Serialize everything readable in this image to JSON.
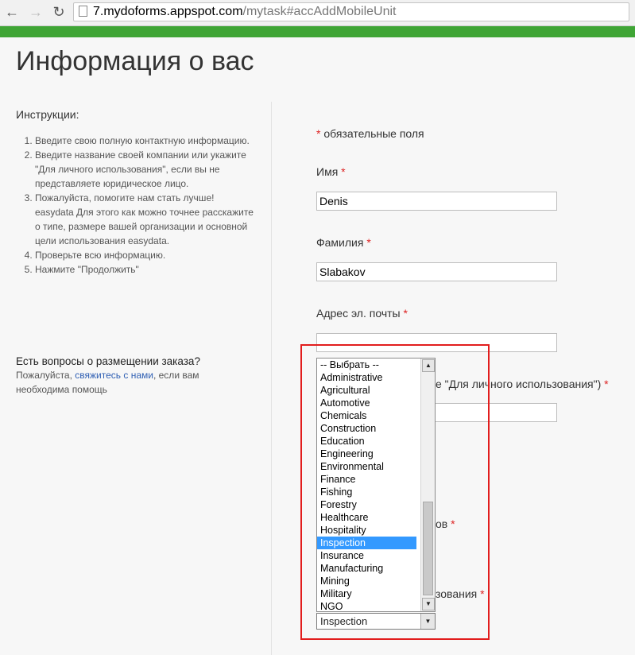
{
  "browser": {
    "url_host": "7.mydoforms.appspot.com",
    "url_path": "/mytask#accAddMobileUnit"
  },
  "page": {
    "title": "Информация о вас"
  },
  "instructions": {
    "title": "Инструкции:",
    "items": [
      "Введите свою полную контактную информацию.",
      "Введите название своей компании или укажите \"Для личного использования\", если вы не представляете юридическое лицо.",
      "Пожалуйста, помогите нам стать лучше! easydata Для этого как можно точнее расскажите о типе, размере вашей организации и основной цели использования easydata.",
      "Проверьте всю информацию.",
      "Нажмите \"Продолжить\""
    ]
  },
  "faq": {
    "title": "Есть вопросы о размещении заказа?",
    "prefix": "Пожалуйста, ",
    "link": "свяжитесь с нами",
    "suffix": ", если вам необходима помощь"
  },
  "form": {
    "required_note": " обязательные поля",
    "required_mark": "*",
    "first_name_label": "Имя ",
    "first_name_value": "Denis",
    "last_name_label": "Фамилия ",
    "last_name_value": "Slabakov",
    "email_label": "Адрес эл. почты ",
    "email_value": "",
    "company_label_partial": "е \"Для личного использования\") ",
    "size_label_partial": "ов ",
    "usage_label_partial": "зования "
  },
  "industry_dropdown": {
    "options": [
      "-- Выбрать --",
      "Administrative",
      "Agricultural",
      "Automotive",
      "Chemicals",
      "Construction",
      "Education",
      "Engineering",
      "Environmental",
      "Finance",
      "Fishing",
      "Forestry",
      "Healthcare",
      "Hospitality",
      "Inspection",
      "Insurance",
      "Manufacturing",
      "Mining",
      "Military",
      "NGO"
    ],
    "selected": "Inspection"
  },
  "colors": {
    "accent_green": "#3fa535",
    "highlight": "#3399ff",
    "annotation_red": "#e21d1d",
    "required_red": "#dd2222"
  }
}
